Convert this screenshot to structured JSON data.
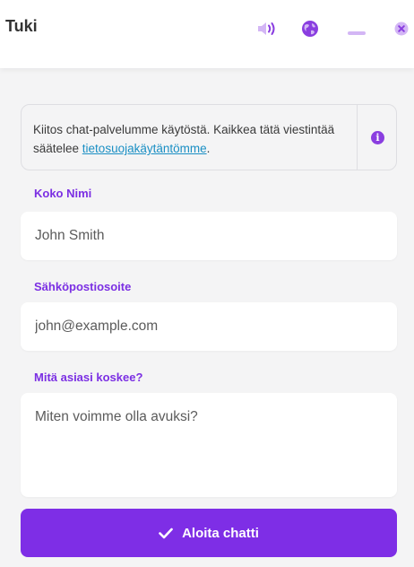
{
  "header": {
    "title": "Tuki",
    "icons": [
      "speaker-icon",
      "globe-icon",
      "minimize-icon",
      "close-icon"
    ]
  },
  "notice": {
    "text_before": "Kiitos chat-palvelumme käytöstä. Kaikkea tätä viestintää säätelee ",
    "link_text": "tietosuojakäytäntömme",
    "text_after": ".",
    "info_glyph": "i"
  },
  "form": {
    "name_label": "Koko Nimi",
    "name_placeholder": "John Smith",
    "email_label": "Sähköpostiosoite",
    "email_placeholder": "john@example.com",
    "topic_label": "Mitä asiasi koskee?",
    "topic_placeholder": "Miten voimme olla avuksi?",
    "submit_label": "Aloita chatti"
  },
  "colors": {
    "accent": "#7e2ee6",
    "label": "#7b2fe3",
    "icon": "#8a3ee0",
    "link": "#1a8fc4",
    "background": "#f4f4f5"
  }
}
